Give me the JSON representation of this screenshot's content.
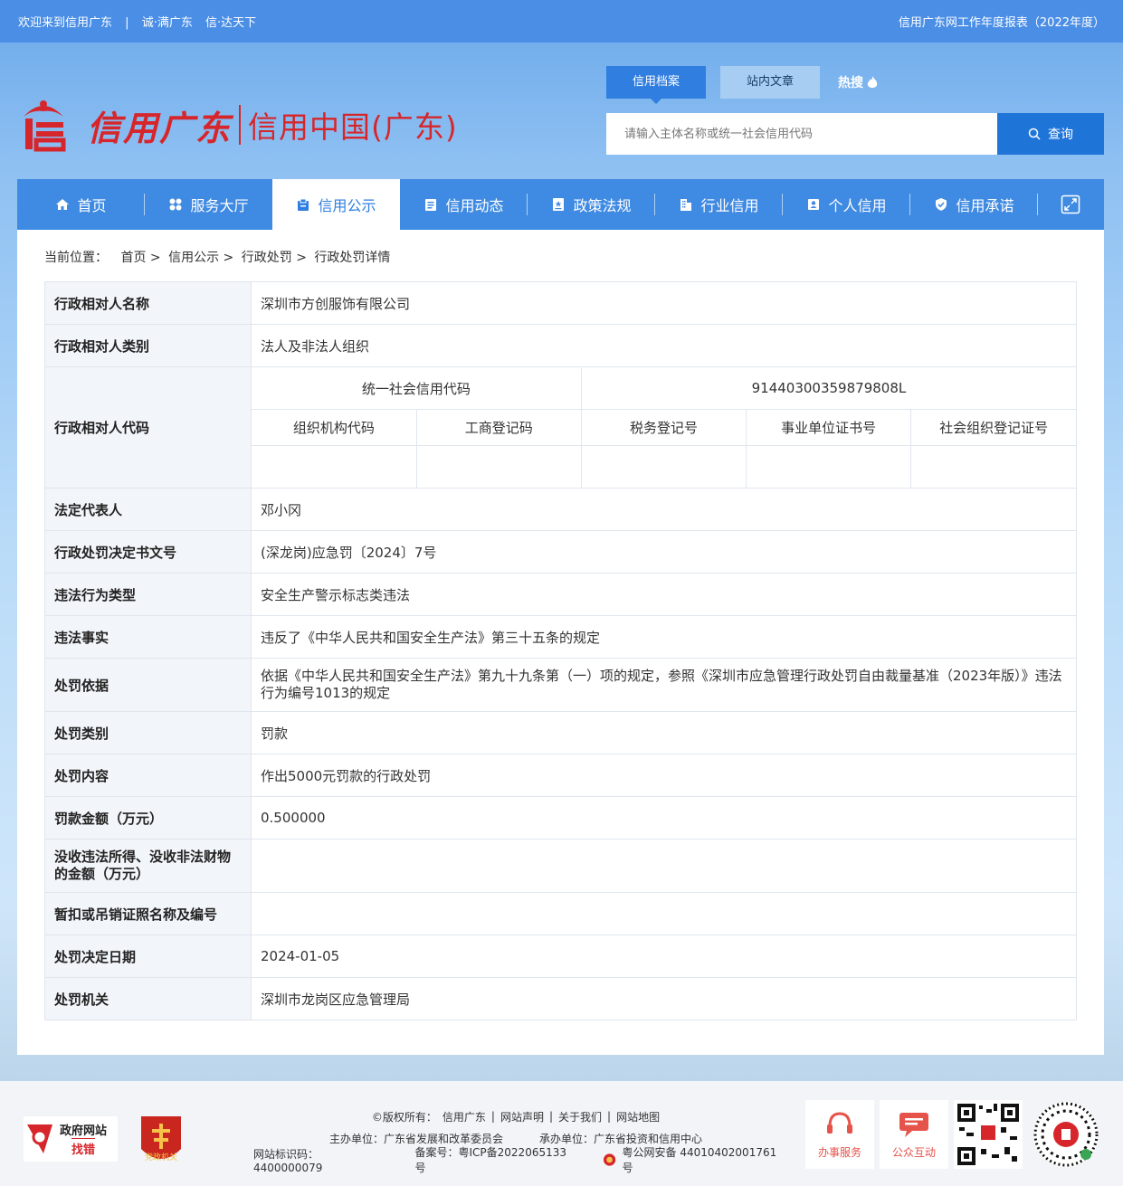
{
  "topbar": {
    "welcome": "欢迎来到信用广东",
    "slogan1": "诚·满广东",
    "slogan2": "信·达天下",
    "report": "信用广东网工作年度报表（2022年度）",
    "separator": "|"
  },
  "logo": {
    "name_cn": "信用广东",
    "name_sub": "信用中国(广东)"
  },
  "search": {
    "tabs": [
      "信用档案",
      "站内文章"
    ],
    "hot_label": "热搜",
    "placeholder": "请输入主体名称或统一社会信用代码",
    "button": "查询"
  },
  "nav": {
    "items": [
      "首页",
      "服务大厅",
      "信用公示",
      "信用动态",
      "政策法规",
      "行业信用",
      "个人信用",
      "信用承诺"
    ]
  },
  "breadcrumb": {
    "label": "当前位置：",
    "path": [
      "首页",
      "信用公示",
      "行政处罚",
      "行政处罚详情"
    ],
    "sep": ">"
  },
  "detail": {
    "name_k": "行政相对人名称",
    "name_v": "深圳市方创服饰有限公司",
    "type_k": "行政相对人类别",
    "type_v": "法人及非法人组织",
    "code_k": "行政相对人代码",
    "uscc_label": "统一社会信用代码",
    "uscc_value": "91440300359879808L",
    "org_code_label": "组织机构代码",
    "biz_reg_label": "工商登记码",
    "tax_reg_label": "税务登记号",
    "inst_cert_label": "事业单位证书号",
    "social_org_label": "社会组织登记证号",
    "legal_k": "法定代表人",
    "legal_v": "邓小冈",
    "docno_k": "行政处罚决定书文号",
    "docno_v": "(深龙岗)应急罚〔2024〕7号",
    "vtype_k": "违法行为类型",
    "vtype_v": "安全生产警示标志类违法",
    "fact_k": "违法事实",
    "fact_v": "违反了《中华人民共和国安全生产法》第三十五条的规定",
    "basis_k": "处罚依据",
    "basis_v": "依据《中华人民共和国安全生产法》第九十九条第（一）项的规定，参照《深圳市应急管理行政处罚自由裁量基准（2023年版）》违法行为编号1013的规定",
    "cat_k": "处罚类别",
    "cat_v": "罚款",
    "content_k": "处罚内容",
    "content_v": "作出5000元罚款的行政处罚",
    "fine_k": "罚款金额（万元）",
    "fine_v": "0.500000",
    "confisc_k": "没收违法所得、没收非法财物的金额（万元）",
    "confisc_v": "",
    "license_k": "暂扣或吊销证照名称及编号",
    "license_v": "",
    "date_k": "处罚决定日期",
    "date_v": "2024-01-05",
    "org_k": "处罚机关",
    "org_v": "深圳市龙岗区应急管理局"
  },
  "footer": {
    "badge1_top": "政府网站",
    "badge1_bottom": "找错",
    "badge2": "党政机关",
    "copyright": "©版权所有：",
    "links": [
      "信用广东",
      "网站声明",
      "关于我们",
      "网站地图"
    ],
    "host": "主办单位：广东省发展和改革委员会",
    "undertake": "承办单位：广东省投资和信用中心",
    "site_id": "网站标识码：4400000079",
    "icp": "备案号：粤ICP备2022065133号",
    "police": "粤公网安备 44010402001761号",
    "svc1": "办事服务",
    "svc2": "公众互动"
  },
  "colors": {
    "primary": "#3f8ae2",
    "brand_red": "#d6262b",
    "button_blue": "#1f74d8"
  }
}
